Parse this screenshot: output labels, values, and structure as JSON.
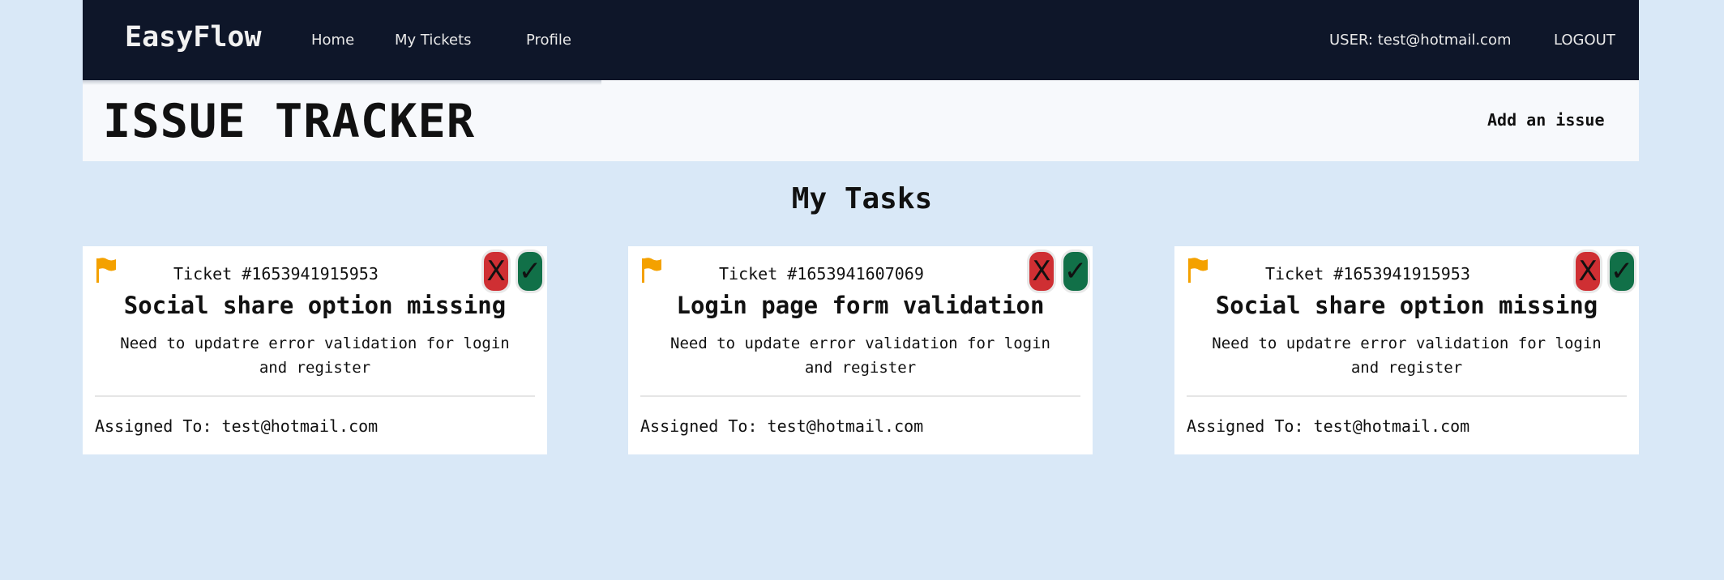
{
  "nav": {
    "brand": "EasyFlow",
    "links": [
      "Home",
      "My Tickets",
      "Profile"
    ],
    "user": "USER: test@hotmail.com",
    "logout": "LOGOUT"
  },
  "header": {
    "title": "ISSUE TRACKER",
    "add_issue": "Add an issue"
  },
  "section_title": "My Tasks",
  "colors": {
    "nav_bg": "#0e1629",
    "page_bg": "#d9e8f7",
    "flag": "#f4a100",
    "reject": "#cf2f33",
    "approve": "#117048"
  },
  "icons": {
    "flag": "flag-icon",
    "reject": "x-icon",
    "approve": "check-icon"
  },
  "cards": [
    {
      "ticket": "Ticket #1653941915953",
      "title": "Social share option missing",
      "description": "Need to updatre error validation for login and register",
      "assigned": "Assigned To: test@hotmail.com",
      "reject_label": "X",
      "approve_label": "✓"
    },
    {
      "ticket": "Ticket #1653941607069",
      "title": "Login page form validation",
      "description": "Need to update error validation for login and register",
      "assigned": "Assigned To: test@hotmail.com",
      "reject_label": "X",
      "approve_label": "✓"
    },
    {
      "ticket": "Ticket #1653941915953",
      "title": "Social share option missing",
      "description": "Need to updatre error validation for login and register",
      "assigned": "Assigned To: test@hotmail.com",
      "reject_label": "X",
      "approve_label": "✓"
    }
  ]
}
